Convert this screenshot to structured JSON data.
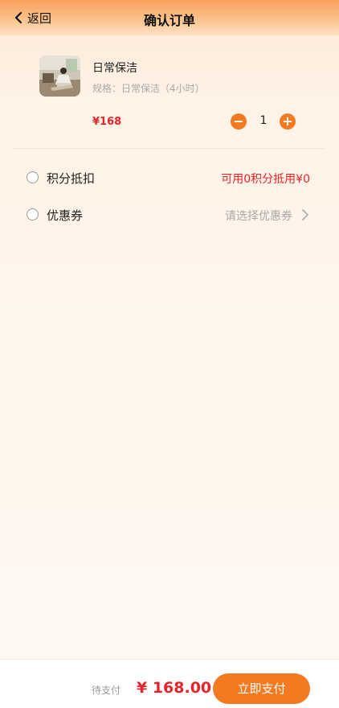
{
  "header": {
    "back_label": "返回",
    "title": "确认订单"
  },
  "product": {
    "name": "日常保洁",
    "spec": "规格：日常保洁（4小时）",
    "price": "¥168",
    "quantity": "1",
    "minus_symbol": "−",
    "plus_symbol": "+"
  },
  "options": {
    "points": {
      "label": "积分抵扣",
      "value": "可用0积分抵用¥0"
    },
    "coupon": {
      "label": "优惠券",
      "placeholder": "请选择优惠券"
    }
  },
  "footer": {
    "pay_hint": "待支付",
    "total": "¥ 168.00",
    "pay_button": "立即支付"
  },
  "colors": {
    "accent": "#f47a22",
    "price_red": "#e8242b",
    "muted": "#a8a8a8"
  }
}
